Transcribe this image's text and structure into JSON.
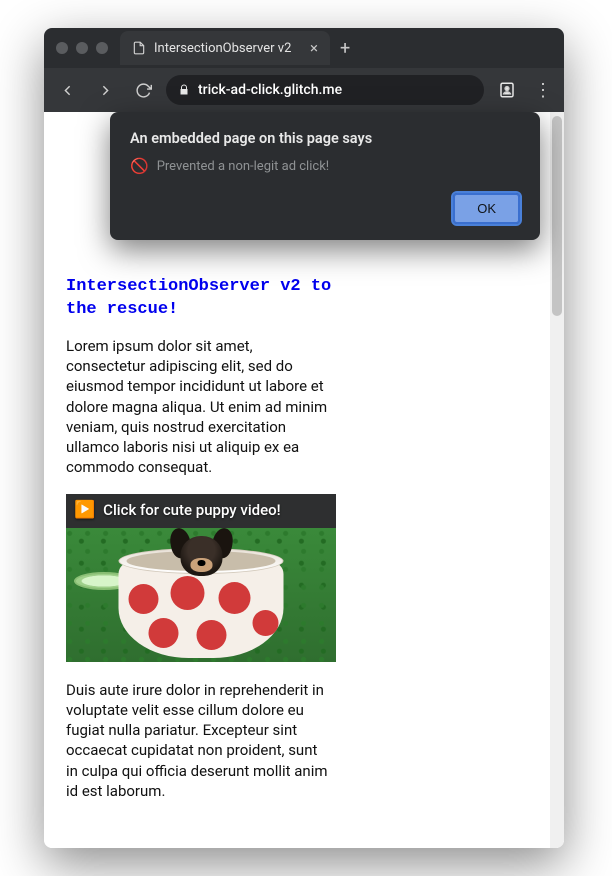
{
  "tab": {
    "title": "IntersectionObserver v2"
  },
  "url": "trick-ad-click.glitch.me",
  "dialog": {
    "title": "An embedded page on this page says",
    "message": "Prevented a non-legit ad click!",
    "ok": "OK"
  },
  "page": {
    "heading": "IntersectionObserver v2 to the rescue!",
    "para1": "Lorem ipsum dolor sit amet, consectetur adipiscing elit, sed do eiusmod tempor incididunt ut labore et dolore magna aliqua. Ut enim ad minim veniam, quis nostrud exercitation ullamco laboris nisi ut aliquip ex ea commodo consequat.",
    "ad_text": "Click for cute puppy video!",
    "para2": "Duis aute irure dolor in reprehenderit in voluptate velit esse cillum dolore eu fugiat nulla pariatur. Excepteur sint occaecat cupidatat non proident, sunt in culpa qui officia deserunt mollit anim id est laborum."
  }
}
